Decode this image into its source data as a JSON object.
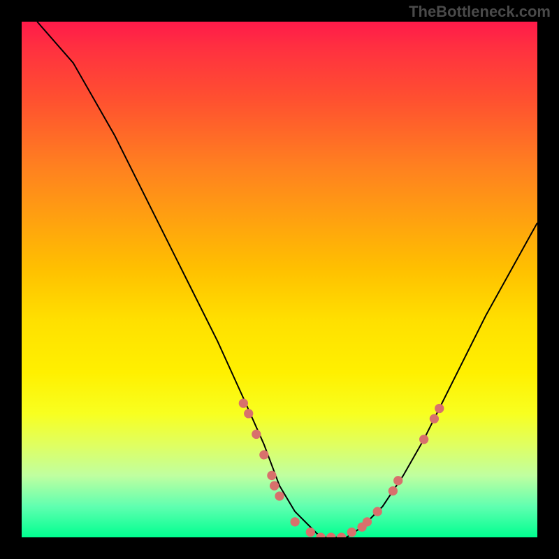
{
  "watermark": "TheBottleneck.com",
  "chart_data": {
    "type": "line",
    "title": "",
    "xlabel": "",
    "ylabel": "",
    "xlim": [
      0,
      100
    ],
    "ylim": [
      0,
      100
    ],
    "series": [
      {
        "name": "bottleneck-curve",
        "x": [
          3,
          10,
          18,
          25,
          32,
          38,
          43,
          47,
          50,
          53,
          56,
          58,
          60,
          63,
          66,
          70,
          74,
          78,
          82,
          86,
          90,
          95,
          100
        ],
        "y": [
          100,
          92,
          78,
          64,
          50,
          38,
          27,
          18,
          10,
          5,
          2,
          0,
          0,
          0,
          2,
          6,
          12,
          19,
          27,
          35,
          43,
          52,
          61
        ]
      }
    ],
    "markers": {
      "name": "data-points",
      "color": "#d8706c",
      "points": [
        {
          "x": 43,
          "y": 26
        },
        {
          "x": 44,
          "y": 24
        },
        {
          "x": 45.5,
          "y": 20
        },
        {
          "x": 47,
          "y": 16
        },
        {
          "x": 48.5,
          "y": 12
        },
        {
          "x": 49,
          "y": 10
        },
        {
          "x": 50,
          "y": 8
        },
        {
          "x": 53,
          "y": 3
        },
        {
          "x": 56,
          "y": 1
        },
        {
          "x": 58,
          "y": 0
        },
        {
          "x": 60,
          "y": 0
        },
        {
          "x": 62,
          "y": 0
        },
        {
          "x": 64,
          "y": 1
        },
        {
          "x": 66,
          "y": 2
        },
        {
          "x": 67,
          "y": 3
        },
        {
          "x": 69,
          "y": 5
        },
        {
          "x": 72,
          "y": 9
        },
        {
          "x": 73,
          "y": 11
        },
        {
          "x": 78,
          "y": 19
        },
        {
          "x": 80,
          "y": 23
        },
        {
          "x": 81,
          "y": 25
        }
      ]
    }
  }
}
